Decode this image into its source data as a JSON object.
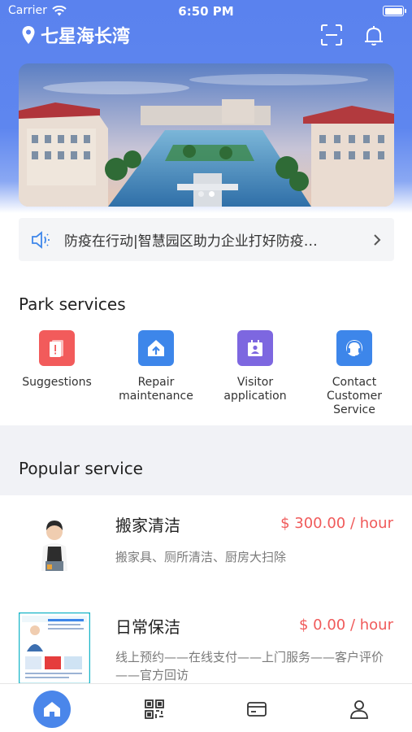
{
  "status_bar": {
    "carrier": "Carrier",
    "time": "6:50 PM"
  },
  "header": {
    "location": "七星海长湾",
    "icons": [
      "scan-icon",
      "bell-icon"
    ]
  },
  "banner": {
    "dots": 2,
    "active_dot": 1
  },
  "notice": {
    "text": "防疫在行动|智慧园区助力企业打好防疫…"
  },
  "park_services": {
    "title": "Park services",
    "items": [
      {
        "label": "Suggestions",
        "icon": "suggestion-icon",
        "color": "#f25b5b"
      },
      {
        "label": "Repair\nmaintenance",
        "icon": "repair-home-icon",
        "color": "#3d86ea"
      },
      {
        "label": "Visitor\napplication",
        "icon": "visitor-badge-icon",
        "color": "#7d67e0"
      },
      {
        "label": "Contact\nCustomer\nService",
        "icon": "headset-icon",
        "color": "#3d86ea"
      }
    ]
  },
  "popular_service": {
    "title": "Popular service",
    "items": [
      {
        "title": "搬家清洁",
        "price": "$ 300.00 / hour",
        "desc": "搬家具、厕所清洁、厨房大扫除"
      },
      {
        "title": "日常保洁",
        "price": "$ 0.00 / hour",
        "desc": "线上预约——在线支付——上门服务——客户评价——官方回访"
      }
    ]
  },
  "tabbar": {
    "items": [
      "home-icon",
      "qr-code-icon",
      "card-icon",
      "profile-icon"
    ],
    "active": 0
  },
  "colors": {
    "accent": "#4a86ea",
    "price": "#f05a5a",
    "hero": "#5a82ee"
  }
}
